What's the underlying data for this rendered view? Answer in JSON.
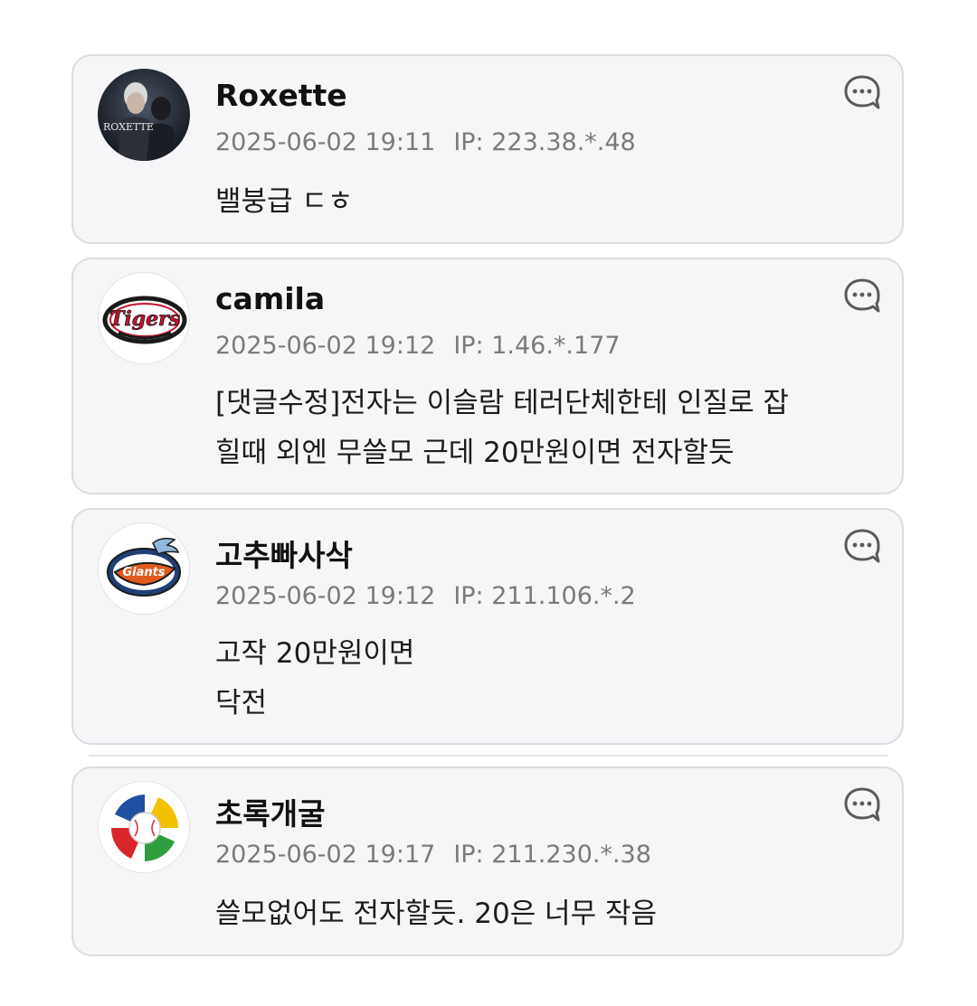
{
  "comments": [
    {
      "nickname": "Roxette",
      "datetime": "2025-06-02 19:11",
      "ip": "IP: 223.38.*.48",
      "text": "밸붕급 ㄷㅎ",
      "avatar": {
        "icon": "roxette-album-avatar",
        "label": "ROXETTE"
      }
    },
    {
      "nickname": "camila",
      "datetime": "2025-06-02 19:12",
      "ip": "IP: 1.46.*.177",
      "text": "[댓글수정]전자는 이슬람 테러단체한테 인질로 잡\n힐때 외엔 무쓸모 근데 20만원이면 전자할듯",
      "avatar": {
        "icon": "tigers-logo-avatar",
        "label": "Tigers"
      }
    },
    {
      "nickname": "고추빠사삭",
      "datetime": "2025-06-02 19:12",
      "ip": "IP: 211.106.*.2",
      "text": "고작 20만원이면\n닥전",
      "avatar": {
        "icon": "giants-logo-avatar",
        "label": "Giants"
      }
    },
    {
      "nickname": "초록개굴",
      "datetime": "2025-06-02 19:17",
      "ip": "IP: 211.230.*.38",
      "text": "쓸모없어도 전자할듯. 20은 너무 작음",
      "avatar": {
        "icon": "wbc-logo-avatar"
      }
    }
  ],
  "reply_icon": "comment-bubble-icon",
  "colors": {
    "card_background": "#f6f6f8",
    "card_border": "#dcdce0",
    "nickname": "#111111",
    "meta": "#7a7a7a",
    "body_text": "#1c1c1c",
    "tigers_red": "#c8102e",
    "giants_orange": "#e05a1e"
  }
}
